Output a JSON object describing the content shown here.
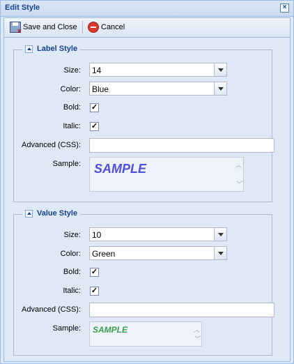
{
  "window": {
    "title": "Edit Style"
  },
  "toolbar": {
    "save_label": "Save and Close",
    "cancel_label": "Cancel"
  },
  "label_style": {
    "legend": "Label Style",
    "size_label": "Size:",
    "size_value": "14",
    "color_label": "Color:",
    "color_value": "Blue",
    "bold_label": "Bold:",
    "bold_checked": true,
    "italic_label": "Italic:",
    "italic_checked": true,
    "advanced_label": "Advanced (CSS):",
    "advanced_value": "",
    "sample_label": "Sample:",
    "sample_text": "SAMPLE",
    "sample_color": "#5050e0"
  },
  "value_style": {
    "legend": "Value Style",
    "size_label": "Size:",
    "size_value": "10",
    "color_label": "Color:",
    "color_value": "Green",
    "bold_label": "Bold:",
    "bold_checked": true,
    "italic_label": "Italic:",
    "italic_checked": true,
    "advanced_label": "Advanced (CSS):",
    "advanced_value": "",
    "sample_label": "Sample:",
    "sample_text": "SAMPLE",
    "sample_color": "#3aa04a"
  },
  "icons": {
    "close": "close-icon",
    "save": "save-icon",
    "cancel": "cancel-icon",
    "collapse": "collapse-icon"
  }
}
